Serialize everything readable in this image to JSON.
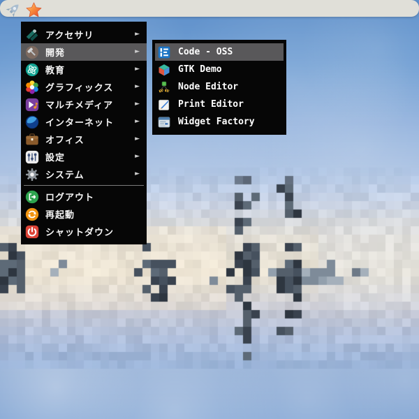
{
  "taskbar": {
    "background_color": "#e0dfd8",
    "icons": [
      {
        "name": "rocket-launcher"
      },
      {
        "name": "star-launcher"
      }
    ]
  },
  "menu": {
    "background_color": "#060606",
    "highlight_color": "#59585a",
    "submenu_arrow": "►",
    "categories": [
      {
        "label": "アクセサリ",
        "icon": "accessories-icon",
        "selected": false
      },
      {
        "label": "開発",
        "icon": "development-icon",
        "selected": true
      },
      {
        "label": "教育",
        "icon": "education-icon",
        "selected": false
      },
      {
        "label": "グラフィックス",
        "icon": "graphics-icon",
        "selected": false
      },
      {
        "label": "マルチメディア",
        "icon": "multimedia-icon",
        "selected": false
      },
      {
        "label": "インターネット",
        "icon": "internet-icon",
        "selected": false
      },
      {
        "label": "オフィス",
        "icon": "office-icon",
        "selected": false
      },
      {
        "label": "設定",
        "icon": "settings-icon",
        "selected": false
      },
      {
        "label": "システム",
        "icon": "system-icon",
        "selected": false
      }
    ],
    "actions": [
      {
        "label": "ログアウト",
        "icon": "logout-icon"
      },
      {
        "label": "再起動",
        "icon": "restart-icon"
      },
      {
        "label": "シャットダウン",
        "icon": "shutdown-icon"
      }
    ]
  },
  "submenu": {
    "items": [
      {
        "label": "Code - OSS",
        "icon": "code-oss-icon",
        "selected": true
      },
      {
        "label": "GTK Demo",
        "icon": "gtk-demo-icon",
        "selected": false
      },
      {
        "label": "Node Editor",
        "icon": "node-editor-icon",
        "selected": false
      },
      {
        "label": "Print Editor",
        "icon": "print-editor-icon",
        "selected": false
      },
      {
        "label": "Widget Factory",
        "icon": "widget-factory-icon",
        "selected": false
      }
    ]
  },
  "background": {
    "sky_top": "#5d8fca",
    "sky_mid": "#b6c9e6",
    "cloud_cream": "#eee6d4",
    "sky_bottom": "#86a8d5",
    "structure_dark": "#39424e",
    "structure_gray": "#7e8b99",
    "pixel_size": 12
  }
}
